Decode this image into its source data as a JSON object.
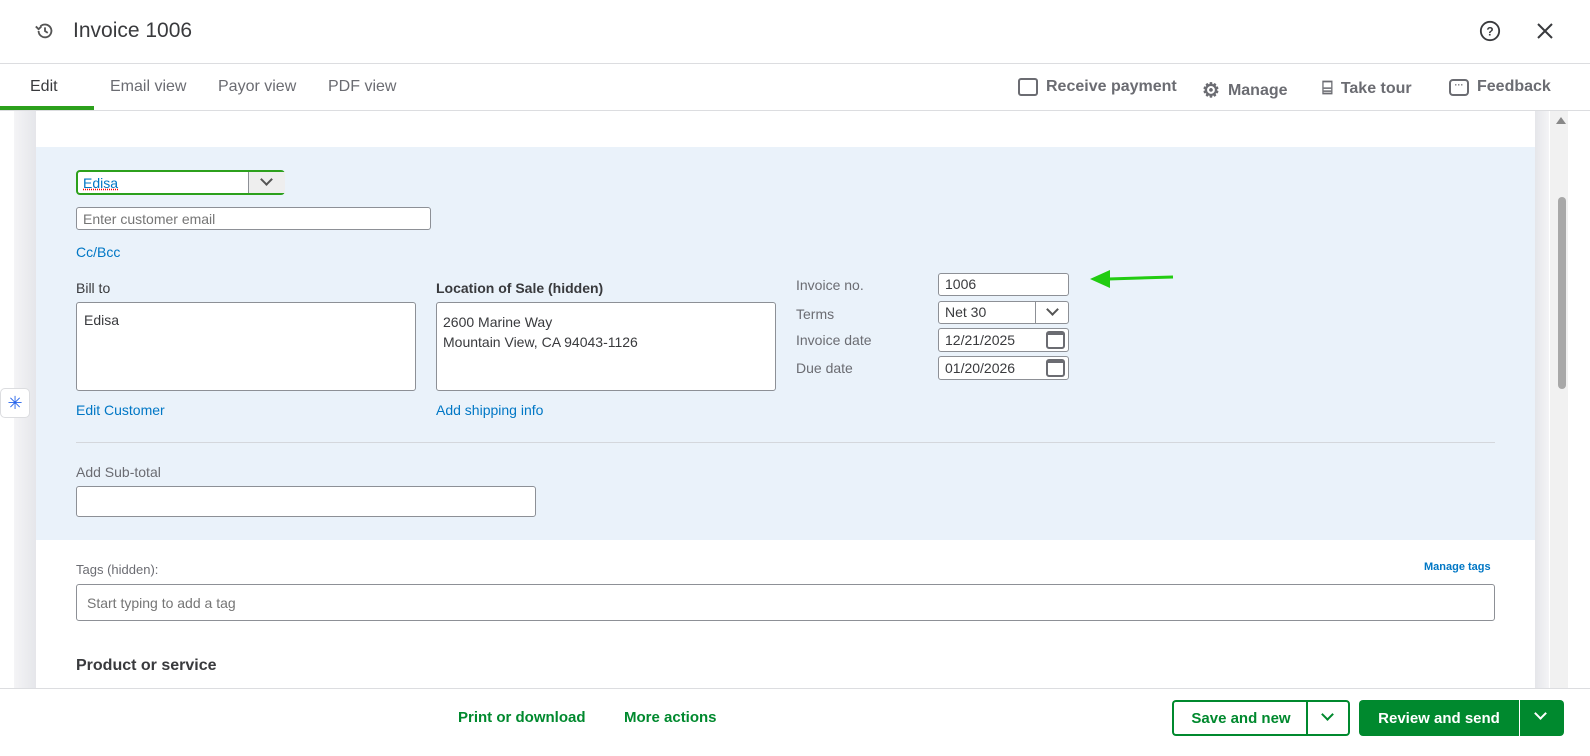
{
  "header": {
    "title": "Invoice 1006"
  },
  "tabs": [
    {
      "label": "Edit"
    },
    {
      "label": "Email view"
    },
    {
      "label": "Payor view"
    },
    {
      "label": "PDF view"
    }
  ],
  "actions": {
    "receive_payment": "Receive payment",
    "manage": "Manage",
    "take_tour": "Take tour",
    "feedback": "Feedback"
  },
  "form": {
    "customer": "Edisa",
    "email_placeholder": "Enter customer email",
    "cc_bcc": "Cc/Bcc",
    "bill_to_label": "Bill to",
    "bill_to_value": "Edisa",
    "edit_customer": "Edit Customer",
    "location_label": "Location of Sale (hidden)",
    "location_line1": "2600 Marine Way",
    "location_line2": "Mountain View, CA 94043-1126",
    "add_shipping": "Add shipping info",
    "invoice_no_label": "Invoice no.",
    "invoice_no": "1006",
    "terms_label": "Terms",
    "terms": "Net 30",
    "invoice_date_label": "Invoice date",
    "invoice_date": "12/21/2025",
    "due_date_label": "Due date",
    "due_date": "01/20/2026",
    "subtotal_label": "Add Sub-total",
    "tags_label": "Tags (hidden):",
    "manage_tags": "Manage tags",
    "tags_placeholder": "Start typing to add a tag",
    "product_heading": "Product or service"
  },
  "footer": {
    "print": "Print or download",
    "more": "More actions",
    "save_new": "Save and new",
    "review_send": "Review and send"
  },
  "colors": {
    "green": "#2ca01c",
    "button_green": "#00892e",
    "link": "#0077c5",
    "panel": "#eaf2fa"
  }
}
